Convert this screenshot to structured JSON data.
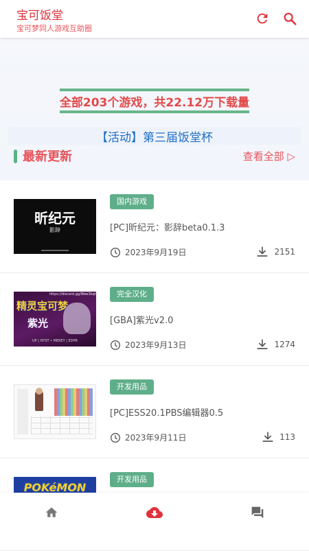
{
  "app": {
    "title": "宝可饭堂",
    "subtitle": "宝可梦同人游戏互助圈"
  },
  "toolbar": {
    "refresh_icon": "refresh-icon",
    "search_icon": "search-icon"
  },
  "hero": {
    "stats_text": "全部203个游戏，共22.12万下载量",
    "banner_text": "【活动】第三届饭堂杯"
  },
  "section": {
    "title": "最新更新",
    "view_all": "查看全部 ▷"
  },
  "games": [
    {
      "tag": "国内游戏",
      "title": "[PC]昕纪元：影辞beta0.1.3",
      "date": "2023年9月19日",
      "downloads": "2151",
      "thumb": {
        "heading": "昕纪元",
        "sub": "影辞"
      }
    },
    {
      "tag": "完全汉化",
      "title": "[GBA]紫光v2.0",
      "date": "2023年9月13日",
      "downloads": "1274",
      "thumb": {
        "heading": "精灵宝可梦",
        "sub": "紫光",
        "url": "https://discord.gg/Wee3kqt",
        "footer": "UP | HYST • MEKEY | EDPR"
      }
    },
    {
      "tag": "开发用品",
      "title": "[PC]ESS20.1PBS编辑器0.5",
      "date": "2023年9月11日",
      "downloads": "113"
    },
    {
      "tag": "开发用品",
      "title": "",
      "date": "",
      "downloads": "",
      "thumb": {
        "heading": "POKéMON"
      }
    }
  ],
  "colors": {
    "accent": "#e0323c",
    "tag_green": "#5fae8a",
    "link_blue": "#1e6fc9"
  },
  "nav": {
    "home_icon": "home-icon",
    "download_icon": "cloud-download-icon",
    "chat_icon": "forum-icon"
  }
}
